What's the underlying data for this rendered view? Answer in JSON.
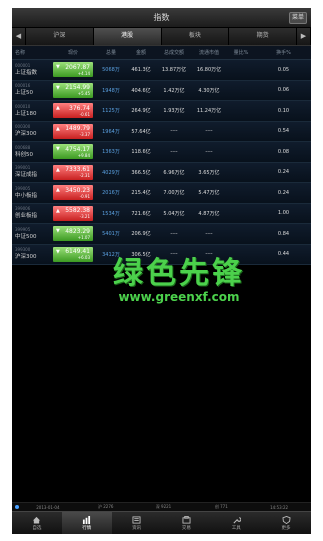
{
  "header": {
    "title": "指数",
    "menu_label": "菜单"
  },
  "tabs": [
    {
      "label": "沪深"
    },
    {
      "label": "港股"
    },
    {
      "label": "板块"
    },
    {
      "label": "期货"
    }
  ],
  "columns": {
    "name": "名称",
    "price": "现价",
    "volume": "总量",
    "amount": "金额",
    "turnover": "总成交额",
    "market_value": "流通市值",
    "ratio": "量比%",
    "extra": "换手%"
  },
  "rows": [
    {
      "code": "000001",
      "name": "上证指数",
      "price": "2067.87",
      "change": "+4.14",
      "dir": "down",
      "volume": "5068万",
      "amount": "461.3亿",
      "turnover": "13.87万亿",
      "market_value": "16.80万亿",
      "ratio": "",
      "extra": "0.05"
    },
    {
      "code": "000016",
      "name": "上证50",
      "price": "2154.99",
      "change": "+5.45",
      "dir": "down",
      "volume": "1948万",
      "amount": "404.6亿",
      "turnover": "1.42万亿",
      "market_value": "4.30万亿",
      "ratio": "",
      "extra": "0.06"
    },
    {
      "code": "000010",
      "name": "上证180",
      "price": "376.74",
      "change": "-0.61",
      "dir": "up",
      "volume": "1125万",
      "amount": "264.9亿",
      "turnover": "1.93万亿",
      "market_value": "11.24万亿",
      "ratio": "",
      "extra": "0.10"
    },
    {
      "code": "000300",
      "name": "沪深300",
      "price": "1489.79",
      "change": "-3.37",
      "dir": "up",
      "volume": "1964万",
      "amount": "57.64亿",
      "turnover": "----",
      "market_value": "----",
      "ratio": "",
      "extra": "0.54"
    },
    {
      "code": "000688",
      "name": "科创50",
      "price": "4754.17",
      "change": "+9.84",
      "dir": "down",
      "volume": "1363万",
      "amount": "118.6亿",
      "turnover": "----",
      "market_value": "----",
      "ratio": "",
      "extra": "0.08"
    },
    {
      "code": "399001",
      "name": "深证成指",
      "price": "7333.61",
      "change": "-2.31",
      "dir": "up",
      "volume": "4029万",
      "amount": "366.5亿",
      "turnover": "6.96万亿",
      "market_value": "3.65万亿",
      "ratio": "",
      "extra": "0.24"
    },
    {
      "code": "399005",
      "name": "中小板指",
      "price": "3450.23",
      "change": "-0.91",
      "dir": "up",
      "volume": "2016万",
      "amount": "215.4亿",
      "turnover": "7.00万亿",
      "market_value": "5.47万亿",
      "ratio": "",
      "extra": "0.24"
    },
    {
      "code": "399006",
      "name": "创业板指",
      "price": "5582.38",
      "change": "-3.21",
      "dir": "up",
      "volume": "1534万",
      "amount": "721.6亿",
      "turnover": "5.04万亿",
      "market_value": "4.87万亿",
      "ratio": "",
      "extra": "1.00"
    },
    {
      "code": "399905",
      "name": "中证500",
      "price": "4823.29",
      "change": "+1.07",
      "dir": "down",
      "volume": "5401万",
      "amount": "206.9亿",
      "turnover": "----",
      "market_value": "----",
      "ratio": "",
      "extra": "0.84"
    },
    {
      "code": "399300",
      "name": "沪深300",
      "price": "6149.41",
      "change": "+6.03",
      "dir": "down",
      "volume": "3412万",
      "amount": "306.5亿",
      "turnover": "----",
      "market_value": "----",
      "ratio": "",
      "extra": "0.44"
    }
  ],
  "watermark": {
    "title": "绿色先锋",
    "url": "www.greenxf.com"
  },
  "status": {
    "left": "2013-01-04",
    "mid1": "沪 2276",
    "mid2": "深 9221",
    "mid3": "创 771",
    "right": "14:53:22"
  },
  "nav": [
    {
      "label": "自选"
    },
    {
      "label": "行情"
    },
    {
      "label": "资讯"
    },
    {
      "label": "交易"
    },
    {
      "label": "工具"
    },
    {
      "label": "更多"
    }
  ],
  "colors": {
    "up": "#e03030",
    "down": "#4cb02c",
    "watermark": "#4cd14c"
  }
}
